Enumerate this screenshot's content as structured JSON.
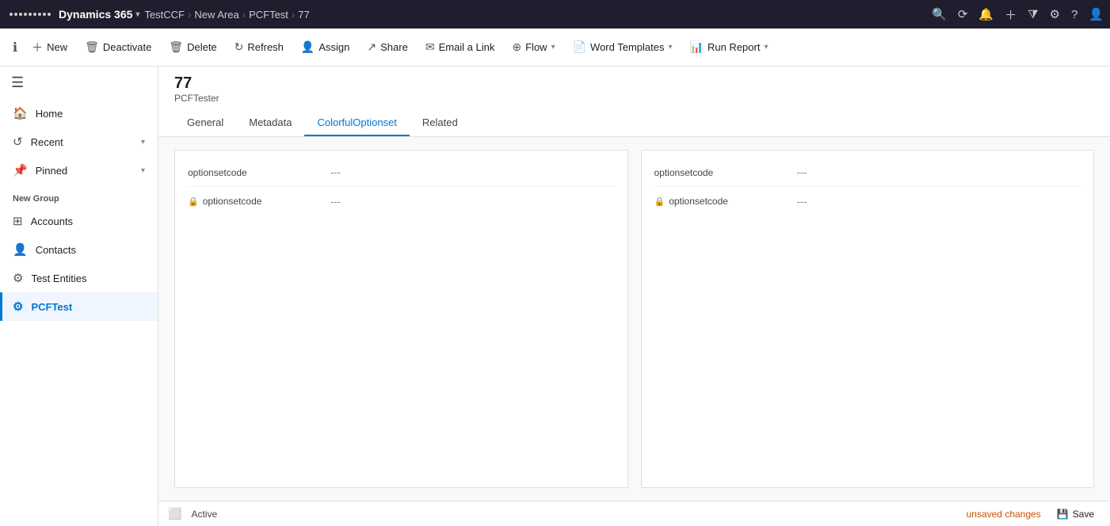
{
  "topnav": {
    "brand": "Dynamics 365",
    "chevron": "▾",
    "path": [
      "TestCCF",
      "New Area",
      "PCFTest",
      "77"
    ],
    "icons": [
      "🔍",
      "⟳",
      "🔔",
      "+",
      "🔽",
      "⚙",
      "?",
      "👤"
    ]
  },
  "toolbar": {
    "info_icon": "ℹ",
    "new_label": "New",
    "deactivate_label": "Deactivate",
    "delete_label": "Delete",
    "refresh_label": "Refresh",
    "assign_label": "Assign",
    "share_label": "Share",
    "email_link_label": "Email a Link",
    "flow_label": "Flow",
    "word_templates_label": "Word Templates",
    "run_report_label": "Run Report"
  },
  "sidebar": {
    "toggle_icon": "☰",
    "home_label": "Home",
    "recent_label": "Recent",
    "pinned_label": "Pinned",
    "section_label": "New Group",
    "items": [
      {
        "label": "Accounts",
        "icon": "⊞"
      },
      {
        "label": "Contacts",
        "icon": "👤"
      },
      {
        "label": "Test Entities",
        "icon": "⚙"
      },
      {
        "label": "PCFTest",
        "icon": "⚙",
        "active": true
      }
    ]
  },
  "record": {
    "title": "77",
    "subtitle": "PCFTester"
  },
  "tabs": [
    {
      "label": "General",
      "active": false
    },
    {
      "label": "Metadata",
      "active": false
    },
    {
      "label": "ColorfulOptionset",
      "active": true
    },
    {
      "label": "Related",
      "active": false
    }
  ],
  "left_section": {
    "fields": [
      {
        "label": "optionsetcode",
        "value": "---",
        "locked": false
      },
      {
        "label": "optionsetcode",
        "value": "---",
        "locked": true
      }
    ]
  },
  "right_section": {
    "fields": [
      {
        "label": "optionsetcode",
        "value": "---",
        "locked": false
      },
      {
        "label": "optionsetcode",
        "value": "---",
        "locked": true
      }
    ]
  },
  "statusbar": {
    "expand_icon": "⬜",
    "status": "Active",
    "unsaved": "unsaved changes",
    "save_icon": "💾",
    "save_label": "Save"
  },
  "colors": {
    "active_tab": "#0078d4",
    "active_sidebar": "#0078d4"
  }
}
